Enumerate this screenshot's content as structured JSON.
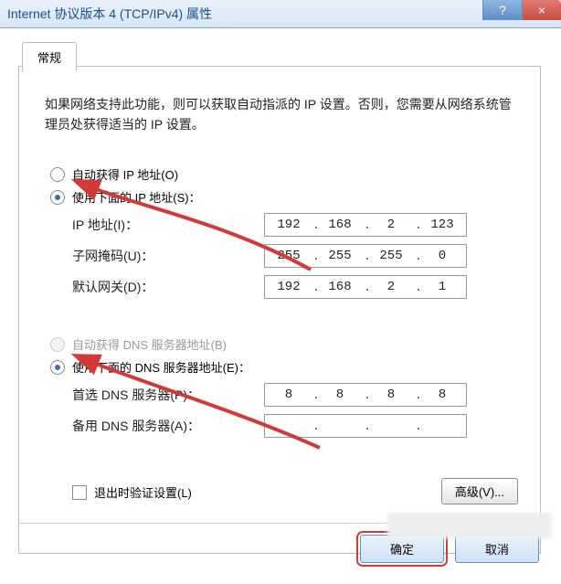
{
  "titlebar": {
    "title": "Internet 协议版本 4 (TCP/IPv4) 属性",
    "help": "?",
    "close": "×"
  },
  "tab": {
    "label": "常规"
  },
  "description": "如果网络支持此功能，则可以获取自动指派的 IP 设置。否则，您需要从网络系统管理员处获得适当的 IP 设置。",
  "ip_section": {
    "auto_label": "自动获得 IP 地址(O)",
    "manual_label": "使用下面的 IP 地址(S)：",
    "selected": "manual",
    "fields": {
      "ip": {
        "label": "IP 地址(I)：",
        "o1": "192",
        "o2": "168",
        "o3": "2",
        "o4": "123"
      },
      "mask": {
        "label": "子网掩码(U)：",
        "o1": "255",
        "o2": "255",
        "o3": "255",
        "o4": "0"
      },
      "gateway": {
        "label": "默认网关(D)：",
        "o1": "192",
        "o2": "168",
        "o3": "2",
        "o4": "1"
      }
    }
  },
  "dns_section": {
    "auto_label": "自动获得 DNS 服务器地址(B)",
    "auto_disabled": true,
    "manual_label": "使用下面的 DNS 服务器地址(E)：",
    "selected": "manual",
    "fields": {
      "pref": {
        "label": "首选 DNS 服务器(P)：",
        "o1": "8",
        "o2": "8",
        "o3": "8",
        "o4": "8"
      },
      "alt": {
        "label": "备用 DNS 服务器(A)：",
        "o1": "",
        "o2": "",
        "o3": "",
        "o4": ""
      }
    }
  },
  "validate_on_exit": {
    "label": "退出时验证设置(L)",
    "checked": false
  },
  "advanced": {
    "label": "高级(V)..."
  },
  "buttons": {
    "ok": "确定",
    "cancel": "取消"
  }
}
